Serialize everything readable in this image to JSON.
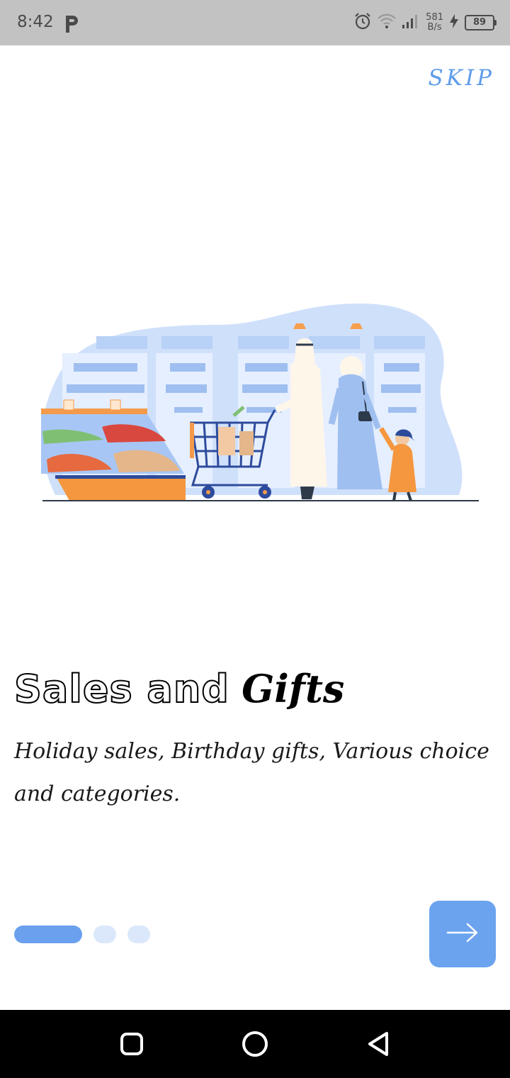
{
  "status_bar": {
    "time": "8:42",
    "net_speed_value": "581",
    "net_speed_unit": "B/s",
    "battery_level": "89"
  },
  "onboarding": {
    "skip_label": "SKIP",
    "title_outline": "Sales and",
    "title_bold": "Gifts",
    "description": "Holiday sales, Birthday gifts, Various choice and categories.",
    "page_count": 3,
    "current_page": 1
  },
  "colors": {
    "accent": "#6ba3ef",
    "accent_light": "#dbe8fb",
    "skip_text": "#5f9bea",
    "status_bar_bg": "#c2c2c2",
    "nav_bar_bg": "#000000"
  },
  "icons": {
    "next": "arrow-right-icon",
    "nav_home": "home-square-icon",
    "nav_circle": "circle-home-icon",
    "nav_back": "back-triangle-icon"
  }
}
